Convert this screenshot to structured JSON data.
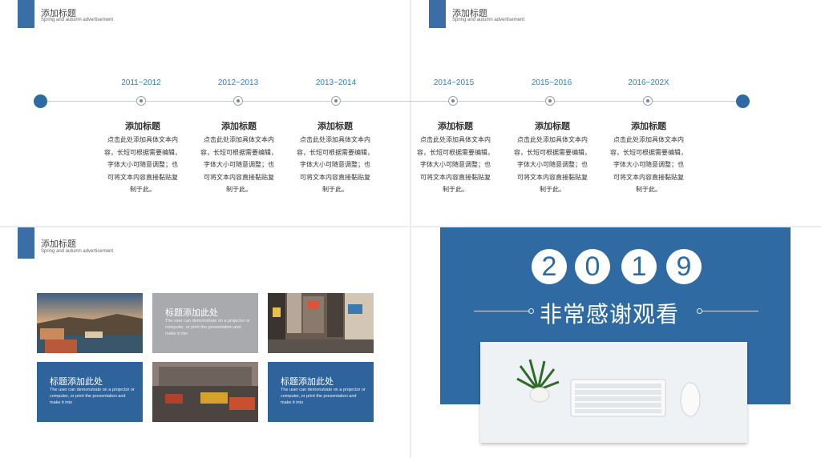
{
  "header": {
    "title": "添加标题",
    "subtitle": "Spring and autumn advertisement"
  },
  "timeline": [
    {
      "year": "2011~2012",
      "title": "添加标题",
      "lines": [
        "点击此处添加具体文本内",
        "容，长短可根据需要编辑，",
        "字体大小可随意调整；也",
        "可将文本内容直接黏贴复",
        "制于此。"
      ]
    },
    {
      "year": "2012~2013",
      "title": "添加标题",
      "lines": [
        "点击此处添加具体文本内",
        "容，长短可根据需要编辑，",
        "字体大小可随意调整；也",
        "可将文本内容直接黏贴复",
        "制于此。"
      ]
    },
    {
      "year": "2013~2014",
      "title": "添加标题",
      "lines": [
        "点击此处添加具体文本内",
        "容，长短可根据需要编辑，",
        "字体大小可随意调整；也",
        "可将文本内容直接黏贴复",
        "制于此。"
      ]
    },
    {
      "year": "2014~2015",
      "title": "添加标题",
      "lines": [
        "点击此处添加具体文本内",
        "容，长短可根据需要编辑，",
        "字体大小可随意调整；也",
        "可将文本内容直接黏贴复",
        "制于此。"
      ]
    },
    {
      "year": "2015~2016",
      "title": "添加标题",
      "lines": [
        "点击此处添加具体文本内",
        "容，长短可根据需要编辑，",
        "字体大小可随意调整；也",
        "可将文本内容直接黏贴复",
        "制于此。"
      ]
    },
    {
      "year": "2016~202X",
      "title": "添加标题",
      "lines": [
        "点击此处添加具体文本内",
        "容，长短可根据需要编辑，",
        "字体大小可随意调整；也",
        "可将文本内容直接黏贴复",
        "制于此。"
      ]
    }
  ],
  "cards": [
    {
      "title": "标题添加此处",
      "text": "The user can demonstrate on a projector or computer, or print the presentation and make it into"
    },
    {
      "title": "标题添加此处",
      "text": "The user can demonstrate on a projector or computer, or print the presentation and make it into"
    },
    {
      "title": "标题添加此处",
      "text": "The user can demonstrate on a projector or computer, or print the presentation and make it into"
    }
  ],
  "thanks": {
    "digits": [
      "2",
      "0",
      "1",
      "9"
    ],
    "text": "非常感谢观看"
  },
  "colors": {
    "accent": "#2f6aa3",
    "year": "#2d7fc0",
    "gray_card": "#a9aaad"
  }
}
